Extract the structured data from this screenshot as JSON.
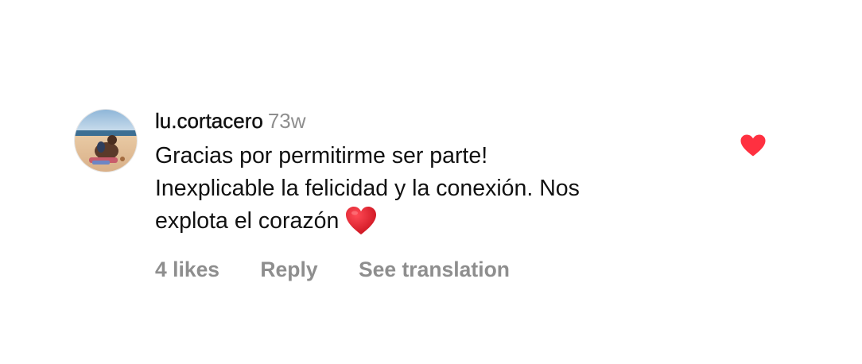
{
  "comment": {
    "username": "lu.cortacero",
    "timestamp": "73w",
    "text_lines": [
      "Gracias por permitirme ser parte!",
      "Inexplicable la felicidad y la conexión. Nos",
      "explota el corazón"
    ],
    "emoji": "heart-emoji",
    "likes_label": "4 likes",
    "reply_label": "Reply",
    "translate_label": "See translation",
    "liked": true
  },
  "colors": {
    "secondary_text": "#8e8e8e",
    "like_red": "#ff3040",
    "emoji_red": "#e0101e"
  },
  "icons": {
    "like": "heart-icon",
    "avatar": "profile-photo"
  }
}
